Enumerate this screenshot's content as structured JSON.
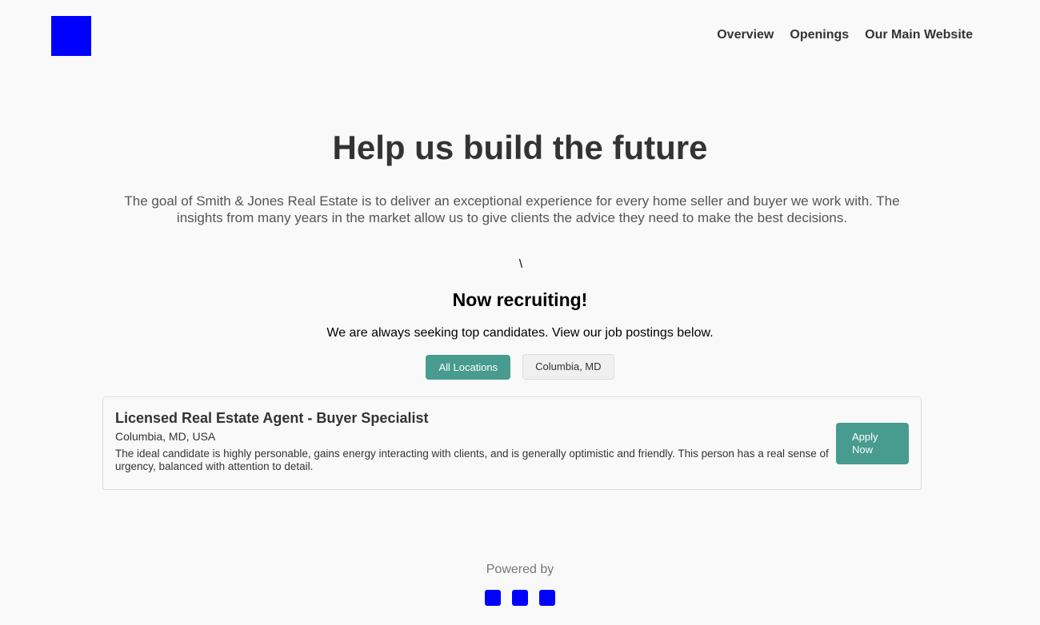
{
  "header": {
    "nav": [
      "Overview",
      "Openings",
      "Our Main Website"
    ]
  },
  "hero": {
    "title": "Help us build the future",
    "description": "The goal of Smith & Jones Real Estate is to deliver an exceptional experience for every home seller and buyer we work with. The insights from many years in the market allow us to give clients the advice they need to make the best decisions."
  },
  "stray_text": "\\",
  "recruiting": {
    "title": "Now recruiting!",
    "description": "We are always seeking top candidates. View our job postings below."
  },
  "filters": [
    {
      "label": "All Locations",
      "active": true
    },
    {
      "label": "Columbia, MD",
      "active": false
    }
  ],
  "jobs": [
    {
      "title": "Licensed Real Estate Agent - Buyer Specialist",
      "location": "Columbia, MD, USA",
      "description": "The ideal candidate is highly personable, gains energy interacting with clients, and is generally optimistic and friendly. This person has a real sense of urgency, balanced with attention to detail.",
      "apply_label": "Apply Now"
    }
  ],
  "footer": {
    "powered_by": "Powered by",
    "icons": [
      "social-icon",
      "social-icon",
      "social-icon"
    ]
  },
  "colors": {
    "accent": "#479b8f",
    "logo": "#0000ff",
    "background": "#f9f9f9",
    "text": "#333333"
  }
}
